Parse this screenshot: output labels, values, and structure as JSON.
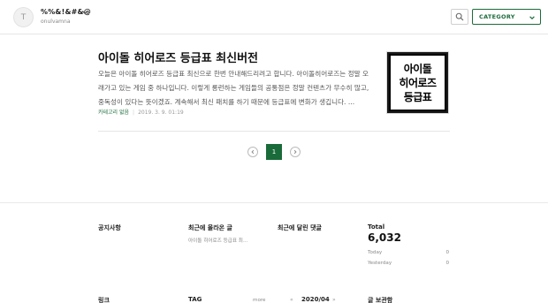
{
  "header": {
    "avatar_initial": "T",
    "blog_title": "%%&!&#&@",
    "blog_owner": "onulvamna",
    "category_label": "CATEGORY",
    "search_icon": "search-icon",
    "accent_color": "#1a6b3a"
  },
  "post": {
    "title": "아이돌 히어로즈 등급표 최신버전",
    "excerpt": "오늘은 아이돌 히어로즈 등급표 최신으로 한번 안내해드리려고 합니다. 아이돌히어로즈는 정말 오래가고 있는 게임 중 하나입니다. 이렇게 롱런하는 게임들의 공통점은 정말 컨텐츠가 무수히 많고, 중독성이 있다는 뜻이겠죠. 계속해서 최신 패치를 하기 때문에 등급표에 변화가 생깁니다. ...",
    "category": "카테고리 없음",
    "date": "2019. 3. 9. 01:19",
    "thumbnail_lines": [
      "아이돌",
      "히어로즈",
      "등급표"
    ]
  },
  "pagination": {
    "current": "1",
    "prev_icon": "chevron-left-icon",
    "next_icon": "chevron-right-icon"
  },
  "footer": {
    "notice_heading": "공지사항",
    "recent_posts_heading": "최근에 올라온 글",
    "recent_post_item": "아이돌 히어로즈 등급표 최...",
    "recent_comments_heading": "최근에 달린 댓글",
    "total_label": "Total",
    "total_value": "6,032",
    "today_label": "Today",
    "today_value": "0",
    "yesterday_label": "Yesterday",
    "yesterday_value": "0",
    "links_heading": "링크",
    "tag_heading": "TAG",
    "more_label": "more",
    "month_prev": "«",
    "month_label": "2020/04",
    "month_next": "»",
    "archive_heading": "글 보관함"
  }
}
